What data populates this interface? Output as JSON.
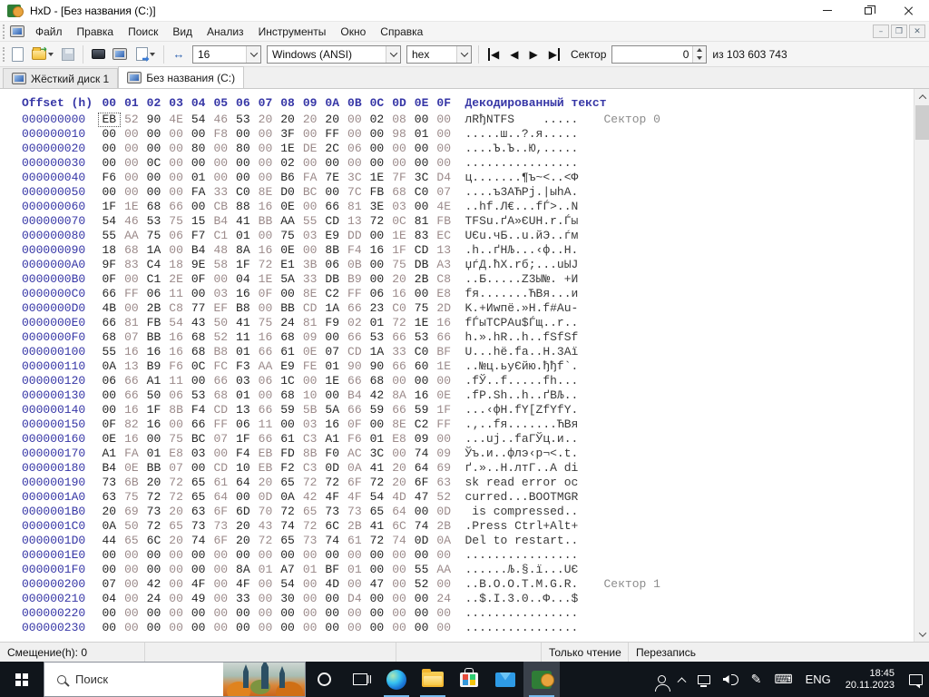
{
  "window": {
    "title": "HxD - [Без названия (C:)]"
  },
  "menu": {
    "items": [
      "Файл",
      "Правка",
      "Поиск",
      "Вид",
      "Анализ",
      "Инструменты",
      "Окно",
      "Справка"
    ]
  },
  "toolbar": {
    "bytes_per_row": "16",
    "encoding": "Windows (ANSI)",
    "numeral_base": "hex",
    "sector_label": "Сектор",
    "sector_value": "0",
    "sector_total": "из 103 603 743"
  },
  "tabs": [
    {
      "label": "Жёсткий диск 1"
    },
    {
      "label": "Без названия (C:)"
    }
  ],
  "hex": {
    "offset_header": "Offset (h)",
    "byte_headers": [
      "00",
      "01",
      "02",
      "03",
      "04",
      "05",
      "06",
      "07",
      "08",
      "09",
      "0A",
      "0B",
      "0C",
      "0D",
      "0E",
      "0F"
    ],
    "text_header": "Декодированный текст",
    "rows": [
      {
        "offset": "000000000",
        "bytes": "EB 52 90 4E 54 46 53 20 20 20 20 00 02 08 00 00",
        "text": "лRђNTFS    .....",
        "sector": "Сектор 0"
      },
      {
        "offset": "000000010",
        "bytes": "00 00 00 00 00 F8 00 00 3F 00 FF 00 00 98 01 00",
        "text": ".....ш..?.я....."
      },
      {
        "offset": "000000020",
        "bytes": "00 00 00 00 80 00 80 00 1E DE 2C 06 00 00 00 00",
        "text": "....Ъ.Ъ..Ю,....."
      },
      {
        "offset": "000000030",
        "bytes": "00 00 0C 00 00 00 00 00 02 00 00 00 00 00 00 00",
        "text": "................"
      },
      {
        "offset": "000000040",
        "bytes": "F6 00 00 00 01 00 00 00 B6 FA 7E 3C 1E 7F 3C D4",
        "text": "ц.......¶ъ~<..<Ф"
      },
      {
        "offset": "000000050",
        "bytes": "00 00 00 00 FA 33 C0 8E D0 BC 00 7C FB 68 C0 07",
        "text": "....ъ3АЋРј.|ыhА."
      },
      {
        "offset": "000000060",
        "bytes": "1F 1E 68 66 00 CB 88 16 0E 00 66 81 3E 03 00 4E",
        "text": "..hf.Л€...fЃ>..N"
      },
      {
        "offset": "000000070",
        "bytes": "54 46 53 75 15 B4 41 BB AA 55 CD 13 72 0C 81 FB",
        "text": "TFSu.ґA»ЄUН.r.Ѓы"
      },
      {
        "offset": "000000080",
        "bytes": "55 AA 75 06 F7 C1 01 00 75 03 E9 DD 00 1E 83 EC",
        "text": "UЄu.чБ..u.йЭ..ѓм"
      },
      {
        "offset": "000000090",
        "bytes": "18 68 1A 00 B4 48 8A 16 0E 00 8B F4 16 1F CD 13",
        "text": ".h..ґHЉ...‹ф..Н."
      },
      {
        "offset": "0000000A0",
        "bytes": "9F 83 C4 18 9E 58 1F 72 E1 3B 06 0B 00 75 DB A3",
        "text": "џѓД.ћX.rб;...uЫЈ"
      },
      {
        "offset": "0000000B0",
        "bytes": "0F 00 C1 2E 0F 00 04 1E 5A 33 DB B9 00 20 2B C8",
        "text": "..Б.....Z3Ы№. +И"
      },
      {
        "offset": "0000000C0",
        "bytes": "66 FF 06 11 00 03 16 0F 00 8E C2 FF 06 16 00 E8",
        "text": "fя.......ЋВя...и"
      },
      {
        "offset": "0000000D0",
        "bytes": "4B 00 2B C8 77 EF B8 00 BB CD 1A 66 23 C0 75 2D",
        "text": "K.+Иwпё.»Н.f#Аu-"
      },
      {
        "offset": "0000000E0",
        "bytes": "66 81 FB 54 43 50 41 75 24 81 F9 02 01 72 1E 16",
        "text": "fЃыTCPAu$Ѓщ..r.."
      },
      {
        "offset": "0000000F0",
        "bytes": "68 07 BB 16 68 52 11 16 68 09 00 66 53 66 53 66",
        "text": "h.».hR..h..fSfSf"
      },
      {
        "offset": "000000100",
        "bytes": "55 16 16 16 68 B8 01 66 61 0E 07 CD 1A 33 C0 BF",
        "text": "U...hё.fa..Н.3Аї"
      },
      {
        "offset": "000000110",
        "bytes": "0A 13 B9 F6 0C FC F3 AA E9 FE 01 90 90 66 60 1E",
        "text": "..№ц.ьуЄйю.ђђf`."
      },
      {
        "offset": "000000120",
        "bytes": "06 66 A1 11 00 66 03 06 1C 00 1E 66 68 00 00 00",
        "text": ".fЎ..f.....fh..."
      },
      {
        "offset": "000000130",
        "bytes": "00 66 50 06 53 68 01 00 68 10 00 B4 42 8A 16 0E",
        "text": ".fP.Sh..h..ґBЉ.."
      },
      {
        "offset": "000000140",
        "bytes": "00 16 1F 8B F4 CD 13 66 59 5B 5A 66 59 66 59 1F",
        "text": "...‹фН.fY[ZfYfY."
      },
      {
        "offset": "000000150",
        "bytes": "0F 82 16 00 66 FF 06 11 00 03 16 0F 00 8E C2 FF",
        "text": ".‚..fя.......ЋВя"
      },
      {
        "offset": "000000160",
        "bytes": "0E 16 00 75 BC 07 1F 66 61 C3 A1 F6 01 E8 09 00",
        "text": "...uј..faГЎц.и.."
      },
      {
        "offset": "000000170",
        "bytes": "A1 FA 01 E8 03 00 F4 EB FD 8B F0 AC 3C 00 74 09",
        "text": "Ўъ.и..флэ‹р¬<.t."
      },
      {
        "offset": "000000180",
        "bytes": "B4 0E BB 07 00 CD 10 EB F2 C3 0D 0A 41 20 64 69",
        "text": "ґ.»..Н.лтГ..A di"
      },
      {
        "offset": "000000190",
        "bytes": "73 6B 20 72 65 61 64 20 65 72 72 6F 72 20 6F 63",
        "text": "sk read error oc"
      },
      {
        "offset": "0000001A0",
        "bytes": "63 75 72 72 65 64 00 0D 0A 42 4F 4F 54 4D 47 52",
        "text": "curred...BOOTMGR"
      },
      {
        "offset": "0000001B0",
        "bytes": "20 69 73 20 63 6F 6D 70 72 65 73 73 65 64 00 0D",
        "text": " is compressed.."
      },
      {
        "offset": "0000001C0",
        "bytes": "0A 50 72 65 73 73 20 43 74 72 6C 2B 41 6C 74 2B",
        "text": ".Press Ctrl+Alt+"
      },
      {
        "offset": "0000001D0",
        "bytes": "44 65 6C 20 74 6F 20 72 65 73 74 61 72 74 0D 0A",
        "text": "Del to restart.."
      },
      {
        "offset": "0000001E0",
        "bytes": "00 00 00 00 00 00 00 00 00 00 00 00 00 00 00 00",
        "text": "................"
      },
      {
        "offset": "0000001F0",
        "bytes": "00 00 00 00 00 00 8A 01 A7 01 BF 01 00 00 55 AA",
        "text": "......Љ.§.ї...UЄ"
      },
      {
        "offset": "000000200",
        "bytes": "07 00 42 00 4F 00 4F 00 54 00 4D 00 47 00 52 00",
        "text": "..B.O.O.T.M.G.R.",
        "sector": "Сектор 1"
      },
      {
        "offset": "000000210",
        "bytes": "04 00 24 00 49 00 33 00 30 00 00 D4 00 00 00 24",
        "text": "..$.I.3.0..Ф...$"
      },
      {
        "offset": "000000220",
        "bytes": "00 00 00 00 00 00 00 00 00 00 00 00 00 00 00 00",
        "text": "................"
      },
      {
        "offset": "000000230",
        "bytes": "00 00 00 00 00 00 00 00 00 00 00 00 00 00 00 00",
        "text": "................"
      }
    ]
  },
  "statusbar": {
    "offset": "Смещение(h): 0",
    "readonly": "Только чтение",
    "overwrite": "Перезапись"
  },
  "taskbar": {
    "search_placeholder": "Поиск",
    "lang": "ENG",
    "time": "18:45",
    "date": "20.11.2023"
  },
  "colors": {
    "accent_underline": "#76b9ed",
    "offset_text": "#3636a6",
    "taskbar_bg": "#10151b"
  }
}
